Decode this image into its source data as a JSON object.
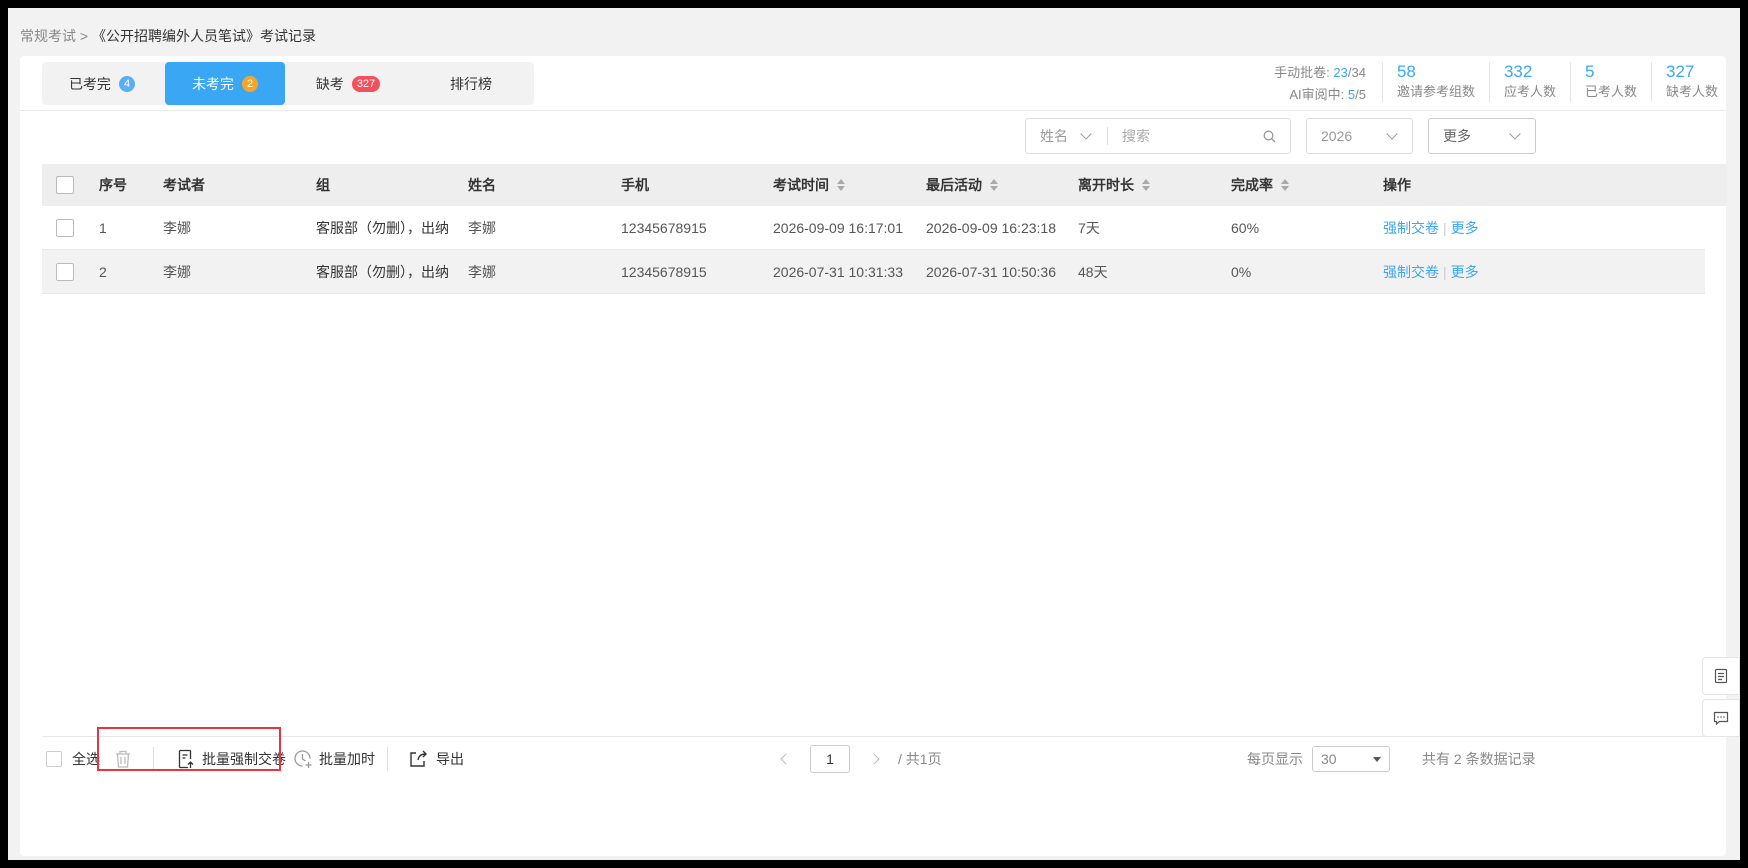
{
  "breadcrumb": {
    "parent": "常规考试",
    "separator": ">",
    "current": "《公开招聘编外人员笔试》考试记录"
  },
  "tabs": [
    {
      "label": "已考完",
      "badge": "4",
      "badge_color": "#5aaef5"
    },
    {
      "label": "未考完",
      "badge": "2",
      "badge_color": "#f7a529"
    },
    {
      "label": "缺考",
      "badge": "327",
      "badge_color": "#f2505b"
    },
    {
      "label": "排行榜"
    }
  ],
  "stats": {
    "manual_grading_label": "手动批卷:",
    "manual_grading_done": "23",
    "manual_grading_total": "/34",
    "ai_review_label": "AI审阅中:",
    "ai_review_done": "5",
    "ai_review_total": "/5",
    "items": [
      {
        "value": "58",
        "label": "邀请参考组数"
      },
      {
        "value": "332",
        "label": "应考人数"
      },
      {
        "value": "5",
        "label": "已考人数"
      },
      {
        "value": "327",
        "label": "缺考人数"
      }
    ]
  },
  "filters": {
    "field_select": "姓名",
    "search_placeholder": "搜索",
    "year_select": "2026",
    "more_select": "更多"
  },
  "table": {
    "columns": [
      "序号",
      "考试者",
      "组",
      "姓名",
      "手机",
      "考试时间",
      "最后活动",
      "离开时长",
      "完成率",
      "操作"
    ],
    "rows": [
      {
        "index": "1",
        "examinee": "李娜",
        "group": "客服部（勿删），出纳",
        "name": "李娜",
        "phone": "12345678915",
        "exam_time": "2026-09-09 16:17:01",
        "last_activity": "2026-09-09 16:23:18",
        "away": "7天",
        "completion": "60%"
      },
      {
        "index": "2",
        "examinee": "李娜",
        "group": "客服部（勿删），出纳",
        "name": "李娜",
        "phone": "12345678915",
        "exam_time": "2026-07-31 10:31:33",
        "last_activity": "2026-07-31 10:50:36",
        "away": "48天",
        "completion": "0%"
      }
    ],
    "action_force_submit": "强制交卷",
    "action_more": "更多"
  },
  "footer": {
    "select_all": "全选",
    "batch_force_submit": "批量强制交卷",
    "batch_add_time": "批量加时",
    "export": "导出",
    "page_current": "1",
    "page_total": "/ 共1页",
    "per_page_label": "每页显示",
    "per_page_value": "30",
    "total_records": "共有 2 条数据记录"
  },
  "colors": {
    "accent": "#3aa7f5",
    "highlight": "#e8343c"
  }
}
